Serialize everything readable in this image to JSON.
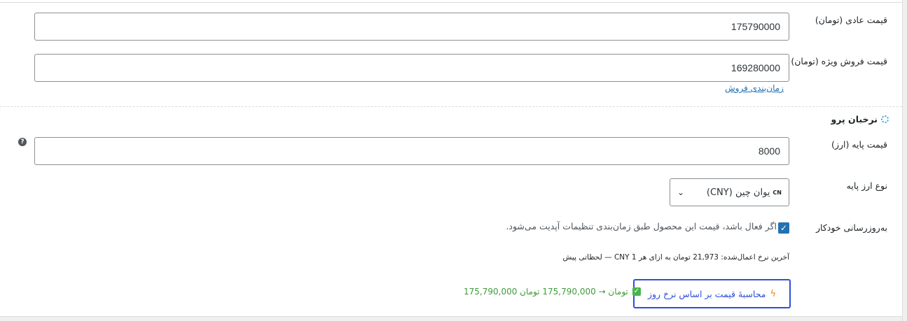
{
  "regular_price": {
    "label": "قیمت عادی (تومان)",
    "value": "175790000"
  },
  "sale_price": {
    "label": "قیمت فروش ویژه (تومان)",
    "value": "169280000",
    "schedule_link": "زمان‌بندی فروش"
  },
  "section": {
    "title": "نرخبان پرو"
  },
  "base_price": {
    "label": "قیمت پایه (ارز)",
    "value": "8000",
    "help": "?"
  },
  "base_currency": {
    "label": "نوع ارز پایه",
    "flag": "CN",
    "selected": "یوان چین (CNY)",
    "chevron": "⌄"
  },
  "auto_update": {
    "label": "به‌روزرسانی خودکار",
    "checked": true,
    "description": "اگر فعال باشد، قیمت این محصول طبق زمان‌بندی تنظیمات آپدیت می‌شود."
  },
  "last_rate": {
    "text": "آخرین نرخ اعمال‌شده: 21,973 تومان به ازای هر 1 CNY — لحظاتی پیش"
  },
  "calc_button": {
    "label": "محاسبهٔ قیمت بر اساس نرخ روز",
    "icon": "bolt-icon"
  },
  "result": {
    "text": "175,790,000 تومان → 175,790,000 تومان",
    "icon": "check-icon"
  },
  "colors": {
    "accent": "#2271b1",
    "button_border": "#2f4fd6",
    "success": "#3f9b3a",
    "bolt": "#f0861b"
  }
}
